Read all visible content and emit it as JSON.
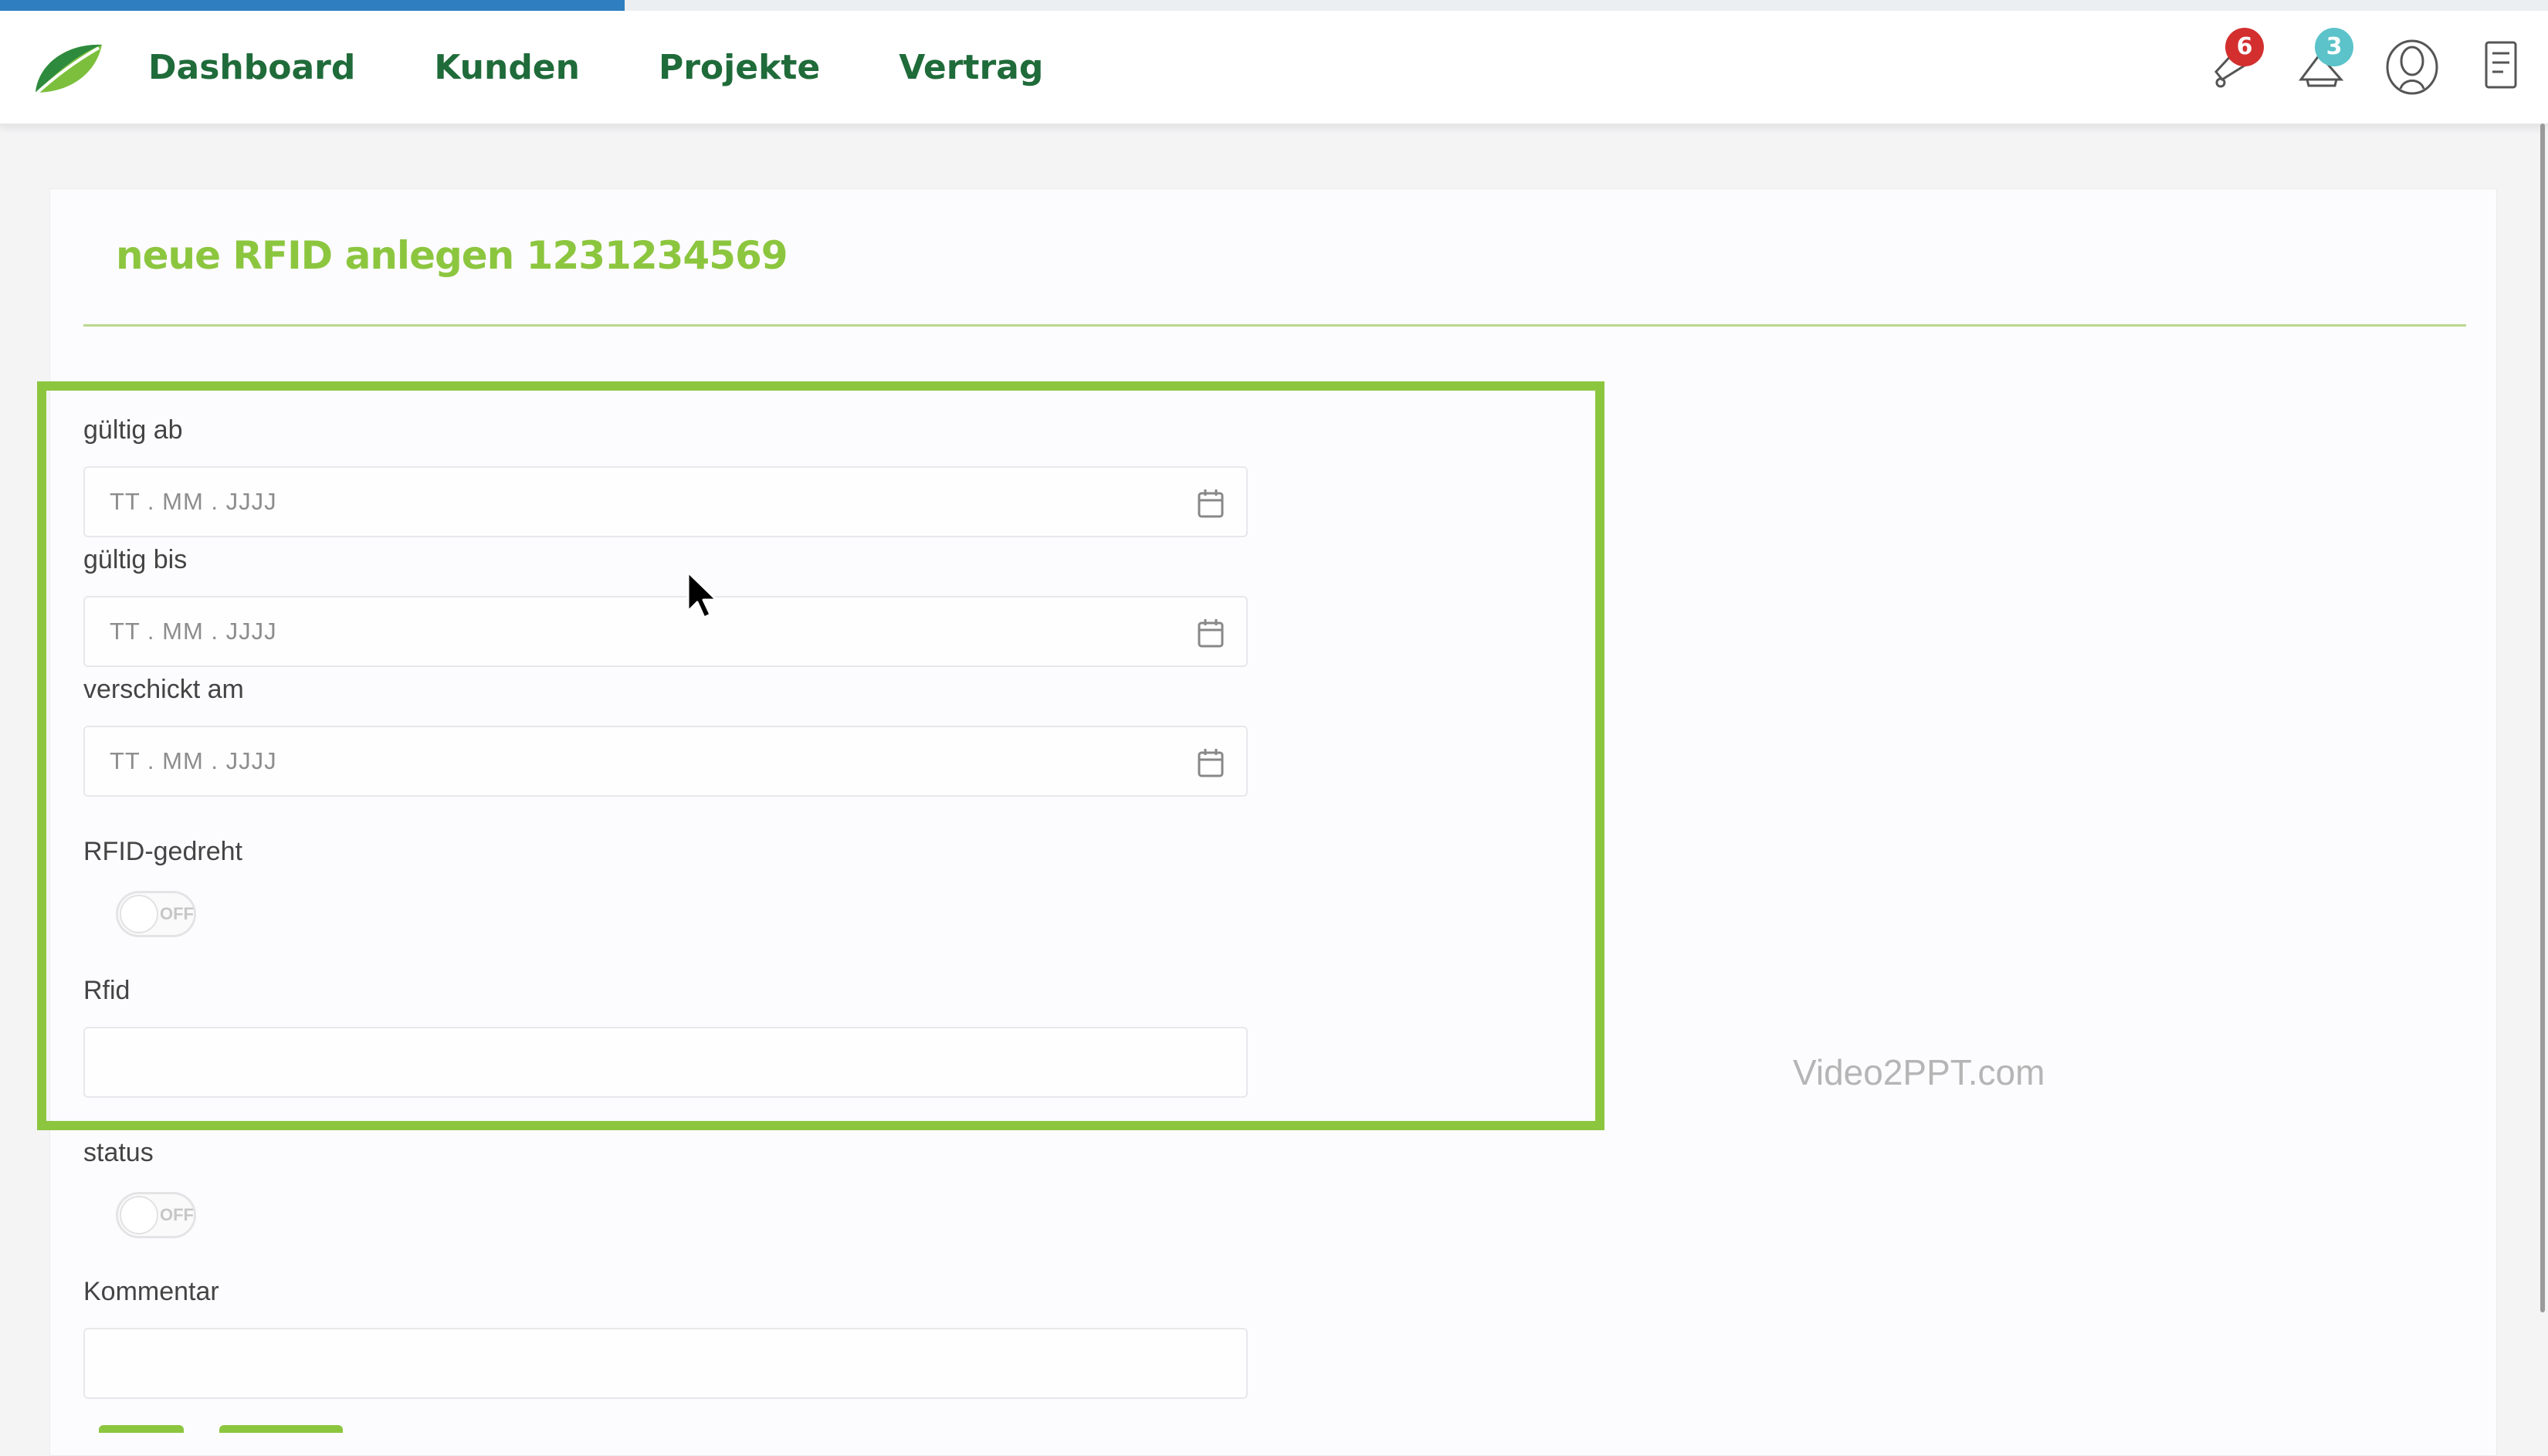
{
  "header": {
    "progress_fraction": 0.245,
    "nav": [
      "Dashboard",
      "Kunden",
      "Projekte",
      "Vertrag"
    ],
    "notification_count": "6",
    "message_count": "3",
    "colors": {
      "nav_text": "#1f6b3a",
      "badge_red": "#d32f2f",
      "badge_teal": "#5bc3c9",
      "accent_green": "#8cc63f"
    },
    "icons": [
      "leaf-logo-icon",
      "bell-icon",
      "megaphone-icon",
      "user-avatar-icon",
      "document-icon"
    ]
  },
  "form": {
    "title": "neue RFID anlegen 1231234569",
    "fields": {
      "valid_from": {
        "label": "gültig ab",
        "placeholder": "TT . MM . JJJJ"
      },
      "valid_to": {
        "label": "gültig bis",
        "placeholder": "TT . MM . JJJJ"
      },
      "sent_on": {
        "label": "verschickt am",
        "placeholder": "TT . MM . JJJJ"
      },
      "rfid_rotated": {
        "label": "RFID-gedreht",
        "state": "OFF"
      },
      "rfid": {
        "label": "Rfid",
        "value": ""
      },
      "status": {
        "label": "status",
        "state": "OFF"
      },
      "comment": {
        "label": "Kommentar",
        "value": ""
      }
    }
  },
  "watermark": "Video2PPT.com"
}
